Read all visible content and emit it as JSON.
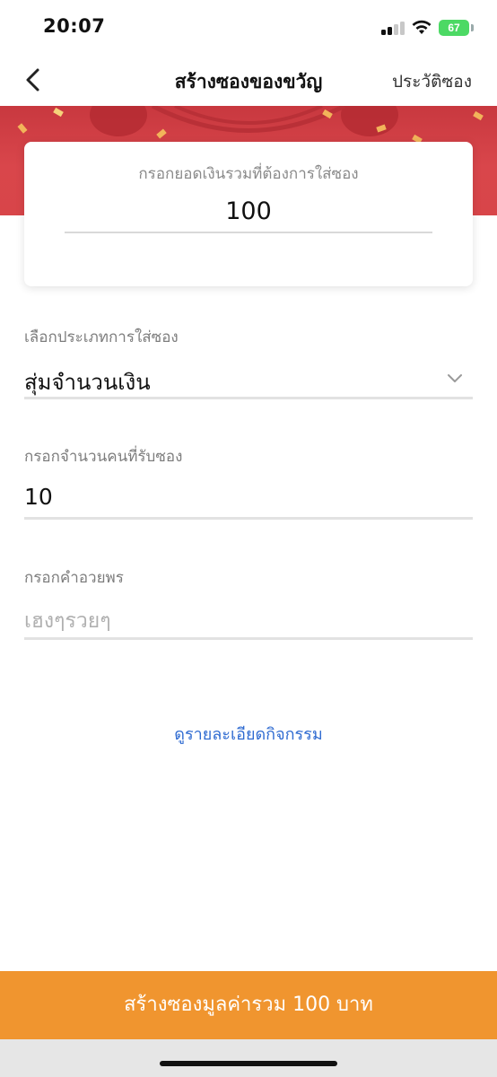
{
  "status_bar": {
    "time": "20:07",
    "battery": "67",
    "icons": [
      "signal-icon",
      "wifi-icon",
      "battery-icon"
    ],
    "battery_color": "#4cd964"
  },
  "nav": {
    "back_icon": "chevron-left-icon",
    "title": "สร้างซองของขวัญ",
    "history_link": "ประวัติซอง"
  },
  "banner": {
    "color": "#d9464b"
  },
  "amount_card": {
    "label": "กรอกยอดเงินรวมที่ต้องการใส่ซอง",
    "value": "100"
  },
  "form": {
    "type_label": "เลือกประเภทการใส่ซอง",
    "type_value": "สุ่มจำนวนเงิน",
    "type_icon": "chevron-down-icon",
    "recipients_label": "กรอกจำนวนคนที่รับซอง",
    "recipients_value": "10",
    "greeting_label": "กรอกคำอวยพร",
    "greeting_placeholder": "เฮงๆรวยๆ"
  },
  "detail_link": "ดูรายละเอียดกิจกรรม",
  "cta": {
    "label": "สร้างซองมูลค่ารวม 100 บาท",
    "color": "#f0952f"
  },
  "accent_link_color": "#2f6bd1"
}
